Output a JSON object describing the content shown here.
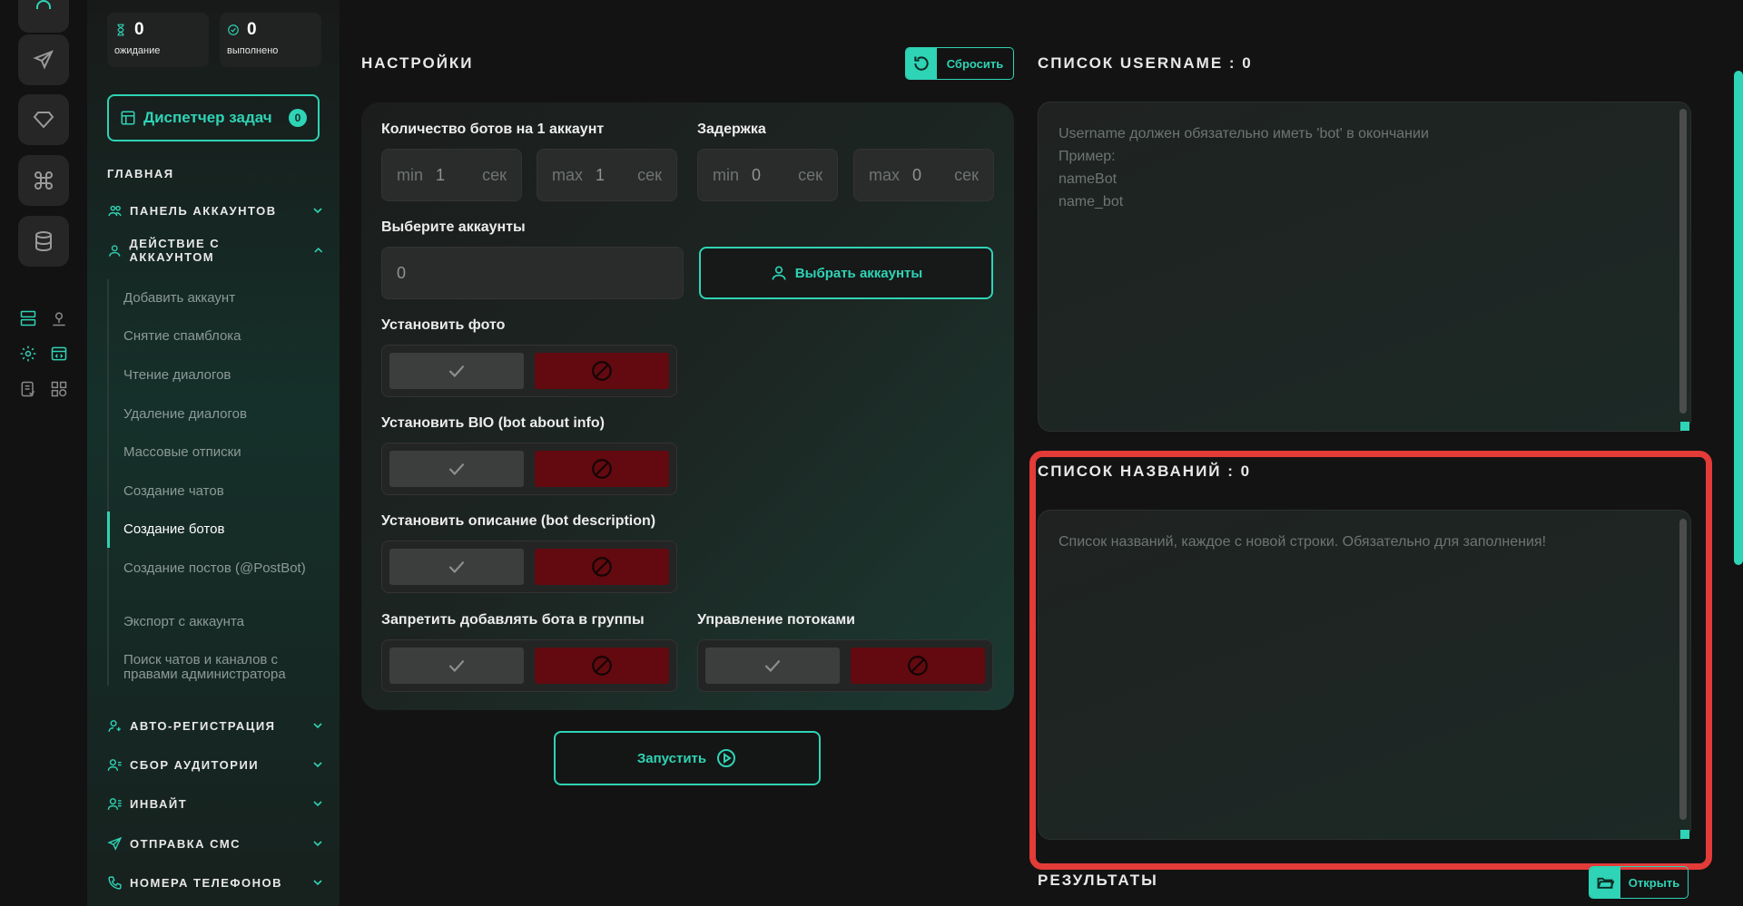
{
  "stats": [
    {
      "value": "0",
      "label": "ожидание"
    },
    {
      "value": "0",
      "label": "выполнено"
    }
  ],
  "dispatcher": {
    "label": "Диспетчер задач",
    "count": "0"
  },
  "sidebar": {
    "section": "ГЛАВНАЯ",
    "groups": {
      "accounts_panel": "ПАНЕЛЬ АККАУНТОВ",
      "account_action": "ДЕЙСТВИЕ С АККАУНТОМ",
      "auto_reg": "АВТО-РЕГИСТРАЦИЯ",
      "audience": "СБОР АУДИТОРИИ",
      "invite": "ИНВАЙТ",
      "sms": "ОТПРАВКА СМС",
      "phones": "НОМЕРА ТЕЛЕФОНОВ"
    },
    "sub_items": [
      "Добавить аккаунт",
      "Снятие спамблока",
      "Чтение диалогов",
      "Удаление диалогов",
      "Массовые отписки",
      "Создание чатов",
      "Создание ботов",
      "Создание постов (@PostBot)",
      "Экспорт с аккаунта",
      "Поиск чатов и каналов с правами администратора"
    ],
    "active_index": 6
  },
  "settings": {
    "title": "НАСТРОЙКИ",
    "reset_label": "Сбросить",
    "bots_per_account": {
      "label": "Количество ботов на 1 аккаунт",
      "min": {
        "prefix": "min",
        "value": "1",
        "unit": "сек"
      },
      "max": {
        "prefix": "max",
        "value": "1",
        "unit": "сек"
      }
    },
    "delay": {
      "label": "Задержка",
      "min": {
        "prefix": "min",
        "value": "0",
        "unit": "сек"
      },
      "max": {
        "prefix": "max",
        "value": "0",
        "unit": "сек"
      }
    },
    "accounts": {
      "label": "Выберите аккаунты",
      "value": "0",
      "button": "Выбрать аккаунты"
    },
    "set_photo": "Установить фото",
    "set_bio": "Установить BIO (bot about info)",
    "set_description": "Установить описание (bot description)",
    "forbid_groups": "Запретить добавлять бота в группы",
    "threads": "Управление потоками",
    "run_label": "Запустить"
  },
  "usernames": {
    "title": "СПИСОК USERNAME : 0",
    "placeholder_lines": [
      "Username должен обязательно иметь 'bot' в окончании",
      "Пример:",
      "nameBot",
      "name_bot"
    ]
  },
  "names": {
    "title": "СПИСОК НАЗВАНИЙ : 0",
    "placeholder": "Список названий, каждое с новой строки. Обязательно для заполнения!"
  },
  "results": {
    "title": "РЕЗУЛЬТАТЫ",
    "open_label": "Открыть"
  },
  "colors": {
    "accent": "#2fd3b5",
    "danger": "#620a10",
    "highlight": "#e23b38"
  }
}
